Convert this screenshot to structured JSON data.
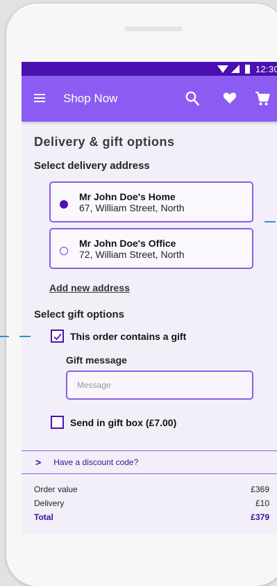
{
  "status": {
    "time": "12:30"
  },
  "appbar": {
    "title": "Shop Now"
  },
  "page": {
    "title": "Delivery & gift options"
  },
  "delivery": {
    "title": "Select delivery address",
    "addresses": [
      {
        "name": "Mr John Doe's Home",
        "line": "67, William Street, North",
        "selected": true
      },
      {
        "name": "Mr John Doe's Office",
        "line": "72, William Street, North",
        "selected": false
      }
    ],
    "add_link": "Add new address"
  },
  "gift": {
    "title": "Select gift options",
    "contains_gift_label": "This order contains a gift",
    "contains_gift_checked": true,
    "message_label": "Gift message",
    "message_placeholder": "Message",
    "gift_box_label": "Send in gift box (£7.00)",
    "gift_box_checked": false
  },
  "discount": {
    "label": "Have a discount code?"
  },
  "summary": {
    "rows": [
      {
        "label": "Order value",
        "value": "£369"
      },
      {
        "label": "Delivery",
        "value": "£10"
      },
      {
        "label": "Total",
        "value": "£379"
      }
    ]
  },
  "colors": {
    "statusbar": "#4a0fb0",
    "appbar": "#8c5cf2",
    "accent": "#4a12b3",
    "border": "#8a5ce8",
    "annotation": "#2f8fd8"
  },
  "icons": [
    "wifi-icon",
    "signal-icon",
    "battery-icon",
    "menu-icon",
    "search-icon",
    "heart-icon",
    "cart-icon",
    "chevron-right-icon",
    "check-icon"
  ]
}
